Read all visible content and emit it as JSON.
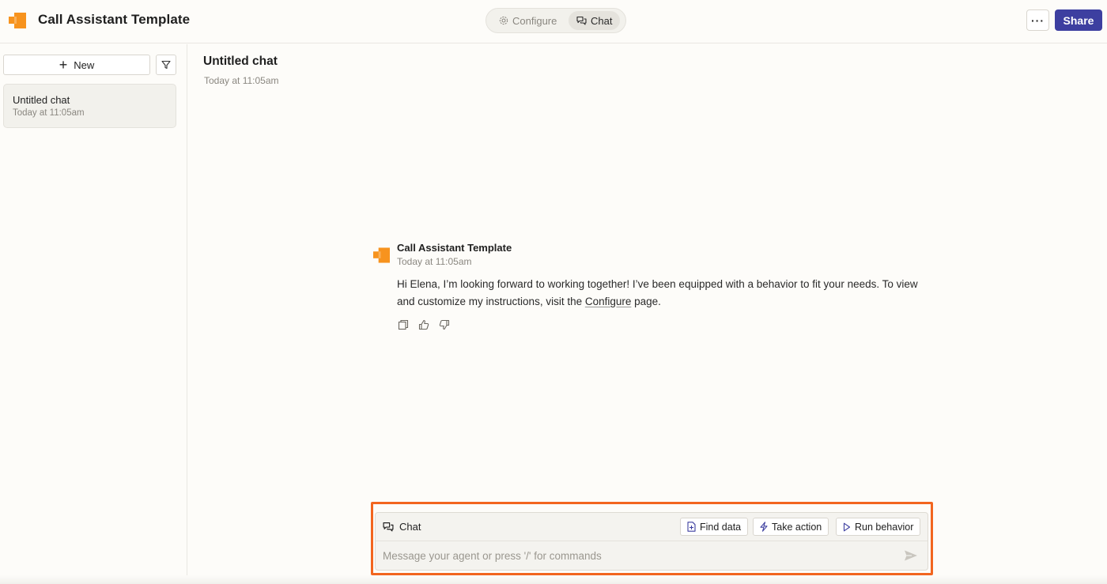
{
  "app": {
    "title": "Call Assistant Template"
  },
  "mode_switch": {
    "configure_label": "Configure",
    "chat_label": "Chat",
    "active": "Chat"
  },
  "header_actions": {
    "more_label": "···",
    "share_label": "Share"
  },
  "sidebar": {
    "new_label": "New",
    "chats": [
      {
        "title": "Untitled chat",
        "time": "Today at 11:05am"
      }
    ]
  },
  "main": {
    "title": "Untitled chat",
    "time": "Today at 11:05am"
  },
  "message": {
    "sender": "Call Assistant Template",
    "time": "Today at 11:05am",
    "text_before_link": "Hi Elena, I’m looking forward to working together! I’ve been equipped with a behavior to fit your needs. To view and customize my instructions, visit the ",
    "link_text": "Configure",
    "text_after_link": " page."
  },
  "composer": {
    "label": "Chat",
    "find_data_label": "Find data",
    "take_action_label": "Take action",
    "run_behavior_label": "Run behavior",
    "placeholder": "Message your agent or press '/' for commands",
    "value": ""
  },
  "colors": {
    "brand_orange": "#f7931e",
    "share_button": "#3d3fa0",
    "highlight_border": "#f2651f",
    "background": "#fdfcf9"
  }
}
